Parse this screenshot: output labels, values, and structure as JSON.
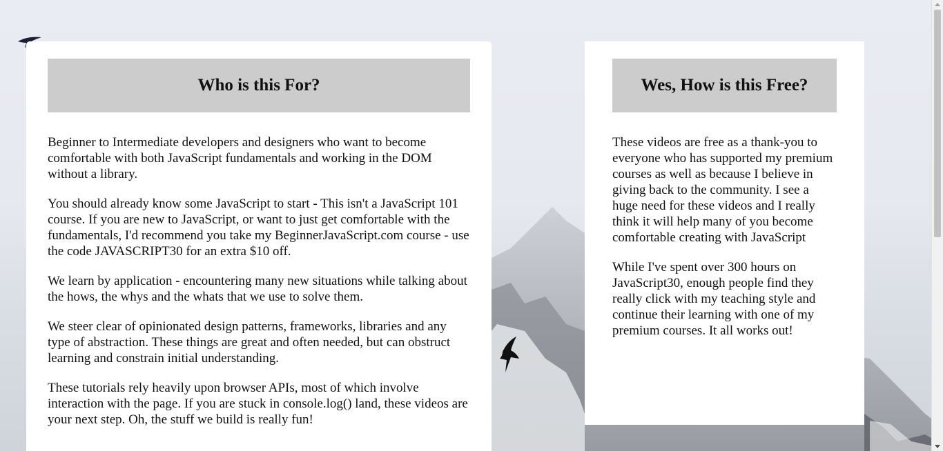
{
  "left_card": {
    "heading": "Who is this For?",
    "paragraphs": [
      "Beginner to Intermediate developers and designers who want to become comfortable with both JavaScript fundamentals and working in the DOM without a library.",
      "You should already know some JavaScript to start - This isn't a JavaScript 101 course. If you are new to JavaScript, or want to just get comfortable with the fundamentals, I'd recommend you take my BeginnerJavaScript.com course - use the code JAVASCRIPT30 for an extra $10 off.",
      "We learn by application - encountering many new situations while talking about the hows, the whys and the whats that we use to solve them.",
      "We steer clear of opinionated design patterns, frameworks, libraries and any type of abstraction. These things are great and often needed, but can obstruct learning and constrain initial understanding.",
      "These tutorials rely heavily upon browser APIs, most of which involve interaction with the page. If you are stuck in console.log() land, these videos are your next step. Oh, the stuff we build is really fun!"
    ]
  },
  "right_card": {
    "heading": "Wes, How is this Free?",
    "paragraphs": [
      "These videos are free as a thank-you to everyone who has supported my premium courses as well as because I believe in giving back to the community. I see a huge need for these videos and I really think it will help many of you become comfortable creating with JavaScript",
      "While I've spent over 300 hours on JavaScript30, enough people find they really click with my teaching style and continue their learning with one of my premium courses. It all works out!"
    ]
  },
  "colors": {
    "card_background": "#ffffff",
    "heading_background": "#cccccc",
    "page_background": "#e9ecf2"
  }
}
